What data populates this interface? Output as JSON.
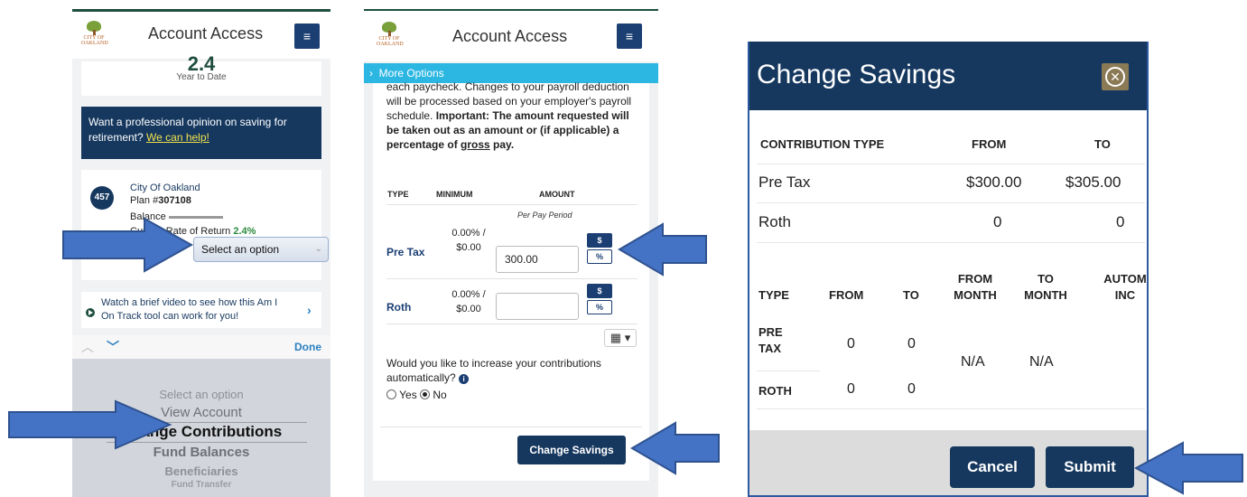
{
  "panel1": {
    "header_title": "Account Access",
    "logo_text": "CITY OF OAKLAND",
    "menu_icon": "hamburger-icon",
    "ytd_value": "2.4",
    "ytd_label": "Year to Date",
    "promo_text": "Want a professional opinion on saving for retirement? ",
    "promo_link": "We can help!",
    "plan": {
      "badge": "457",
      "name": "City Of Oakland",
      "number_label": "Plan #",
      "number": "307108",
      "balance_label": "Balance",
      "rate_label": "Current Rate of Return",
      "rate": "2.4%"
    },
    "select_value": "Select an option",
    "video_text": "Watch a brief video to see how this Am I On Track tool can work for you!",
    "keyboard_done": "Done",
    "picker_options": [
      "Select an option",
      "View Account",
      "Change Contributions",
      "Fund Balances",
      "Beneficiaries",
      "Fund Transfer"
    ]
  },
  "panel2": {
    "header_title": "Account Access",
    "logo_text": "CITY OF OAKLAND",
    "more_options": "More Options",
    "intro_plain": "each paycheck. Changes to your payroll deduction will be processed based on your employer's payroll schedule. ",
    "intro_bold": "Important: The amount requested will be taken out as an amount or (if applicable) a percentage of ",
    "intro_underlined": "gross",
    "intro_end": " pay.",
    "col_type": "TYPE",
    "col_minimum": "MINIMUM",
    "col_amount": "AMOUNT",
    "per_pay_period": "Per Pay Period",
    "rows": [
      {
        "label": "Pre Tax",
        "min_pct": "0.00% /",
        "min_amt": "$0.00",
        "amount": "300.00"
      },
      {
        "label": "Roth",
        "min_pct": "0.00% /",
        "min_amt": "$0.00",
        "amount": ""
      }
    ],
    "dollar_btn": "$",
    "percent_btn": "%",
    "auto_question": "Would you like to increase your contributions automatically?",
    "radio_yes": "Yes",
    "radio_no": "No",
    "radio_selected": "No",
    "change_button": "Change Savings"
  },
  "panel3": {
    "title": "Change Savings",
    "table1": {
      "headers": [
        "CONTRIBUTION TYPE",
        "FROM",
        "TO"
      ],
      "rows": [
        [
          "Pre Tax",
          "$300.00",
          "$305.00"
        ],
        [
          "Roth",
          "0",
          "0"
        ]
      ]
    },
    "table2": {
      "headers": [
        "TYPE",
        "FROM",
        "TO",
        "FROM MONTH",
        "TO MONTH",
        "AUTOMATIC INCREASE"
      ],
      "header_lines": {
        "type": "TYPE",
        "from": "FROM",
        "to": "TO",
        "from_month_1": "FROM",
        "from_month_2": "MONTH",
        "to_month_1": "TO",
        "to_month_2": "MONTH",
        "auto_1": "AUTOM",
        "auto_2": "INC"
      },
      "rows": [
        {
          "type_1": "PRE",
          "type_2": "TAX",
          "from": "0",
          "to": "0"
        },
        {
          "type_1": "ROTH",
          "type_2": "",
          "from": "0",
          "to": "0"
        }
      ],
      "from_month": "N/A",
      "to_month": "N/A"
    },
    "cancel_button": "Cancel",
    "submit_button": "Submit"
  },
  "colors": {
    "navy": "#16385f",
    "accent_blue": "#2cb7e3",
    "arrow_blue": "#4472c4",
    "green": "#1f4e3d"
  }
}
